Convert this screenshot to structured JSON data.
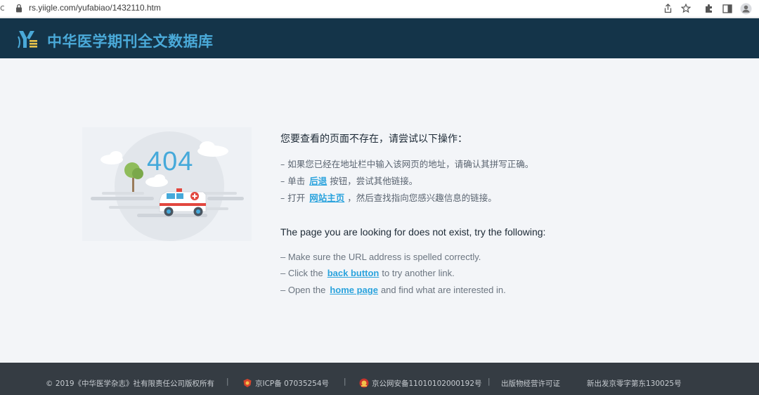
{
  "browser": {
    "url": "rs.yiigle.com/yufabiao/1432110.htm",
    "icons": [
      "lock-icon",
      "share-icon",
      "star-icon",
      "extensions-icon",
      "sidebar-icon",
      "profile-icon"
    ]
  },
  "header": {
    "title": "中华医学期刊全文数据库"
  },
  "illustration": {
    "code": "404"
  },
  "cn": {
    "heading": "您要查看的页面不存在，请尝试以下操作：",
    "item1": "– 如果您已经在地址栏中输入该网页的地址，请确认其拼写正确。",
    "item2_prefix": "– 单击",
    "item2_link": "后退",
    "item2_suffix": "按钮，尝试其他链接。",
    "item3_prefix": "– 打开",
    "item3_link": "网站主页",
    "item3_suffix": "，然后查找指向您感兴趣信息的链接。"
  },
  "en": {
    "heading": "The page you are looking for does not exist, try the following:",
    "item1": "– Make sure the URL address is spelled correctly.",
    "item2_prefix": "– Click the",
    "item2_link": "back button",
    "item2_suffix": "to try another link.",
    "item3_prefix": "– Open the",
    "item3_link": "home page",
    "item3_suffix": "and find what are interested in."
  },
  "footer": {
    "copyright": "© 2019《中华医学杂志》社有限责任公司版权所有",
    "icp": "京ICP备 07035254号",
    "police": "京公网安备11010102000192号",
    "publication": "出版物经营许可证",
    "license": "新出发京零字第东130025号",
    "separator": "|"
  }
}
